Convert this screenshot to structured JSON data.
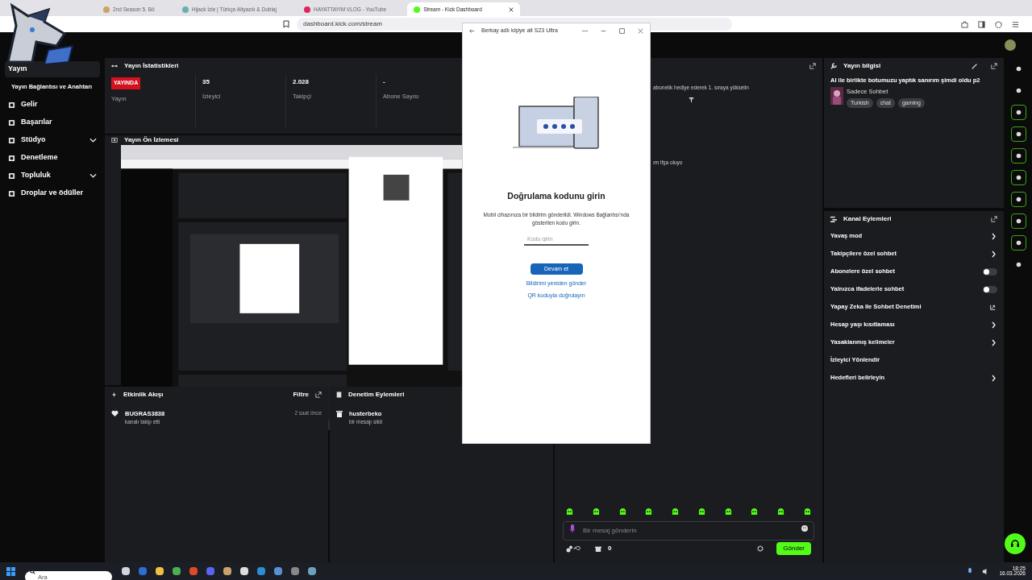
{
  "browser": {
    "tabs": [
      {
        "title": "2nd Season 5. Bö",
        "selected": false
      },
      {
        "title": "Hijack İzle | Türkçe Altyazılı & Dublaj",
        "selected": false
      },
      {
        "title": "HAYATTAYIM VLOG - YouTube",
        "selected": false
      },
      {
        "title": "Stream - Kick Dashboard",
        "selected": true
      }
    ],
    "url": "dashboard.kick.com/stream"
  },
  "sidebar": {
    "items": [
      {
        "label": "Yayın",
        "kind": "top",
        "selected": true
      },
      {
        "label": "Yayın Bağlantısı ve Anahtarı",
        "kind": "sub",
        "selected": false
      },
      {
        "label": "Gelir",
        "kind": "item",
        "selected": false
      },
      {
        "label": "Başarılar",
        "kind": "item",
        "selected": false
      },
      {
        "label": "Stüdyo",
        "kind": "group",
        "selected": false
      },
      {
        "label": "Denetleme",
        "kind": "item",
        "selected": false
      },
      {
        "label": "Topluluk",
        "kind": "group",
        "selected": false
      },
      {
        "label": "Droplar ve ödüller",
        "kind": "item",
        "selected": false
      }
    ]
  },
  "stats": {
    "title": "Yayın İstatistikleri",
    "items": [
      {
        "kind": "badge",
        "value": "YAYINDA",
        "label": "Yayın"
      },
      {
        "kind": "number",
        "value": "35",
        "label": "İzleyici"
      },
      {
        "kind": "number",
        "value": "2.028",
        "label": "Takipçi"
      },
      {
        "kind": "number",
        "value": "-",
        "label": "Abone Sayısı"
      }
    ]
  },
  "preview": {
    "title": "Yayın Ön İzlemesi"
  },
  "activity": {
    "title": "Etkinlik Akışı",
    "filter": "Filtre",
    "events": [
      {
        "user": "BUGRAS3838",
        "action": "kanalı takip etti",
        "time": "2 saat önce"
      }
    ]
  },
  "moderation": {
    "title": "Denetim Eylemleri",
    "actions": [
      {
        "user": "husterbeko",
        "action": "bir mesajı sildi"
      }
    ]
  },
  "chat": {
    "messages": [
      "abonelik hediye ederek 1. sıraya yükselin",
      "ım ifşa oluyo"
    ],
    "placeholder": "Bir mesaj gönderin",
    "count": "0",
    "send": "Gönder"
  },
  "stream_info": {
    "title": "Yayın bilgisi",
    "stream_title": "AI ile birlikte botumuzu yaptık sanırım şimdi oldu p2",
    "category": "Sadece Sohbet",
    "tags": [
      "Turkish",
      "chat",
      "gaming"
    ]
  },
  "channel_actions": {
    "title": "Kanal Eylemleri",
    "items": [
      {
        "label": "Yavaş mod",
        "kind": "chevron"
      },
      {
        "label": "Takipçilere özel sohbet",
        "kind": "chevron"
      },
      {
        "label": "Abonelere özel sohbet",
        "kind": "toggle",
        "on": false
      },
      {
        "label": "Yalnızca ifadelerle sohbet",
        "kind": "toggle",
        "on": false
      },
      {
        "label": "Yapay Zeka ile Sohbet Denetimi",
        "kind": "external"
      },
      {
        "label": "Hesap yaşı kısıtlaması",
        "kind": "chevron"
      },
      {
        "label": "Yasaklanmış kelimeler",
        "kind": "chevron"
      },
      {
        "label": "İzleyici Yönlendir",
        "kind": "plain"
      },
      {
        "label": "Hedefleri belirleyin",
        "kind": "chevron"
      }
    ]
  },
  "dialog": {
    "title": "Berkay adlı kişiye ait S23 Ultra",
    "heading": "Doğrulama kodunu girin",
    "message": "Mobil cihazınıza bir bildirim gönderildi. Windows Bağlantısı'nda gösterilen kodu girin.",
    "placeholder": "Kodu girin",
    "button": "Devam et",
    "links": [
      "Bildirimi yeniden gönder",
      "QR koduyla doğrulayın"
    ]
  },
  "taskbar": {
    "placeholder": "Ara",
    "time": "18:25",
    "date": "16.03.2026"
  }
}
